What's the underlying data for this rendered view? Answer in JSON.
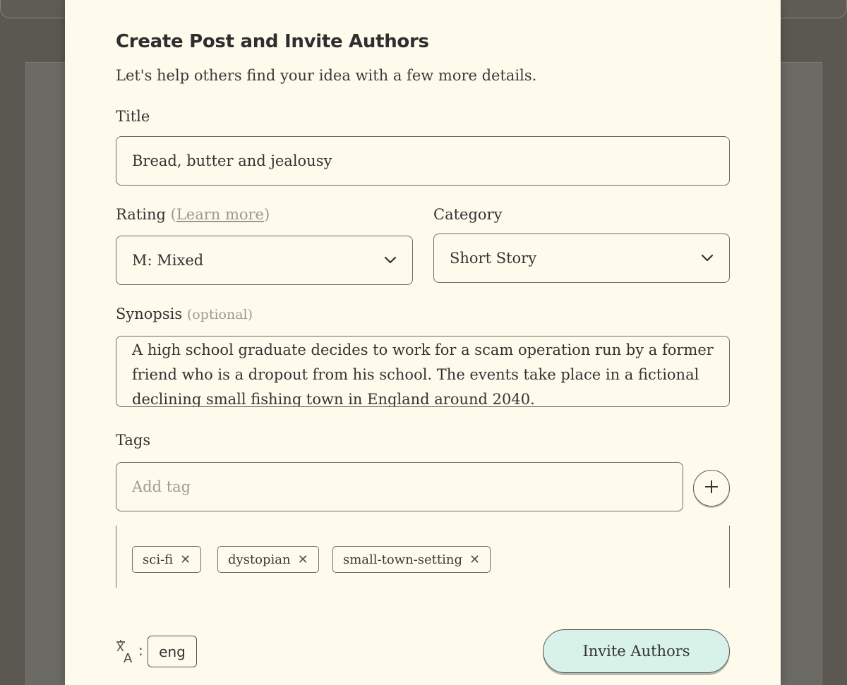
{
  "modal": {
    "heading": "Create Post and Invite Authors",
    "subheading": "Let's help others find your idea with a few more details."
  },
  "title_field": {
    "label": "Title",
    "value": "Bread, butter and jealousy"
  },
  "rating": {
    "label": "Rating",
    "learn_more_open": "(",
    "learn_more": "Learn more",
    "learn_more_close": ")",
    "value": "M: Mixed",
    "icon": "chevron-down-icon"
  },
  "category": {
    "label": "Category",
    "value": "Short Story",
    "icon": "chevron-down-icon"
  },
  "synopsis": {
    "label": "Synopsis",
    "optional": "(optional)",
    "value": "A high school graduate decides to work for a scam operation run by a former friend who is a dropout from his school. The events take place in a fictional declining small fishing town in England around 2040."
  },
  "tags": {
    "label": "Tags",
    "placeholder": "Add tag",
    "add_icon": "plus-icon",
    "items": [
      {
        "label": "sci-fi",
        "remove": "✕"
      },
      {
        "label": "dystopian",
        "remove": "✕"
      },
      {
        "label": "small-town-setting",
        "remove": "✕"
      }
    ]
  },
  "language": {
    "icon": "translate-icon",
    "separator": ":",
    "value": "eng"
  },
  "invite_button": {
    "label": "Invite Authors",
    "color": "#d8f2ea"
  }
}
